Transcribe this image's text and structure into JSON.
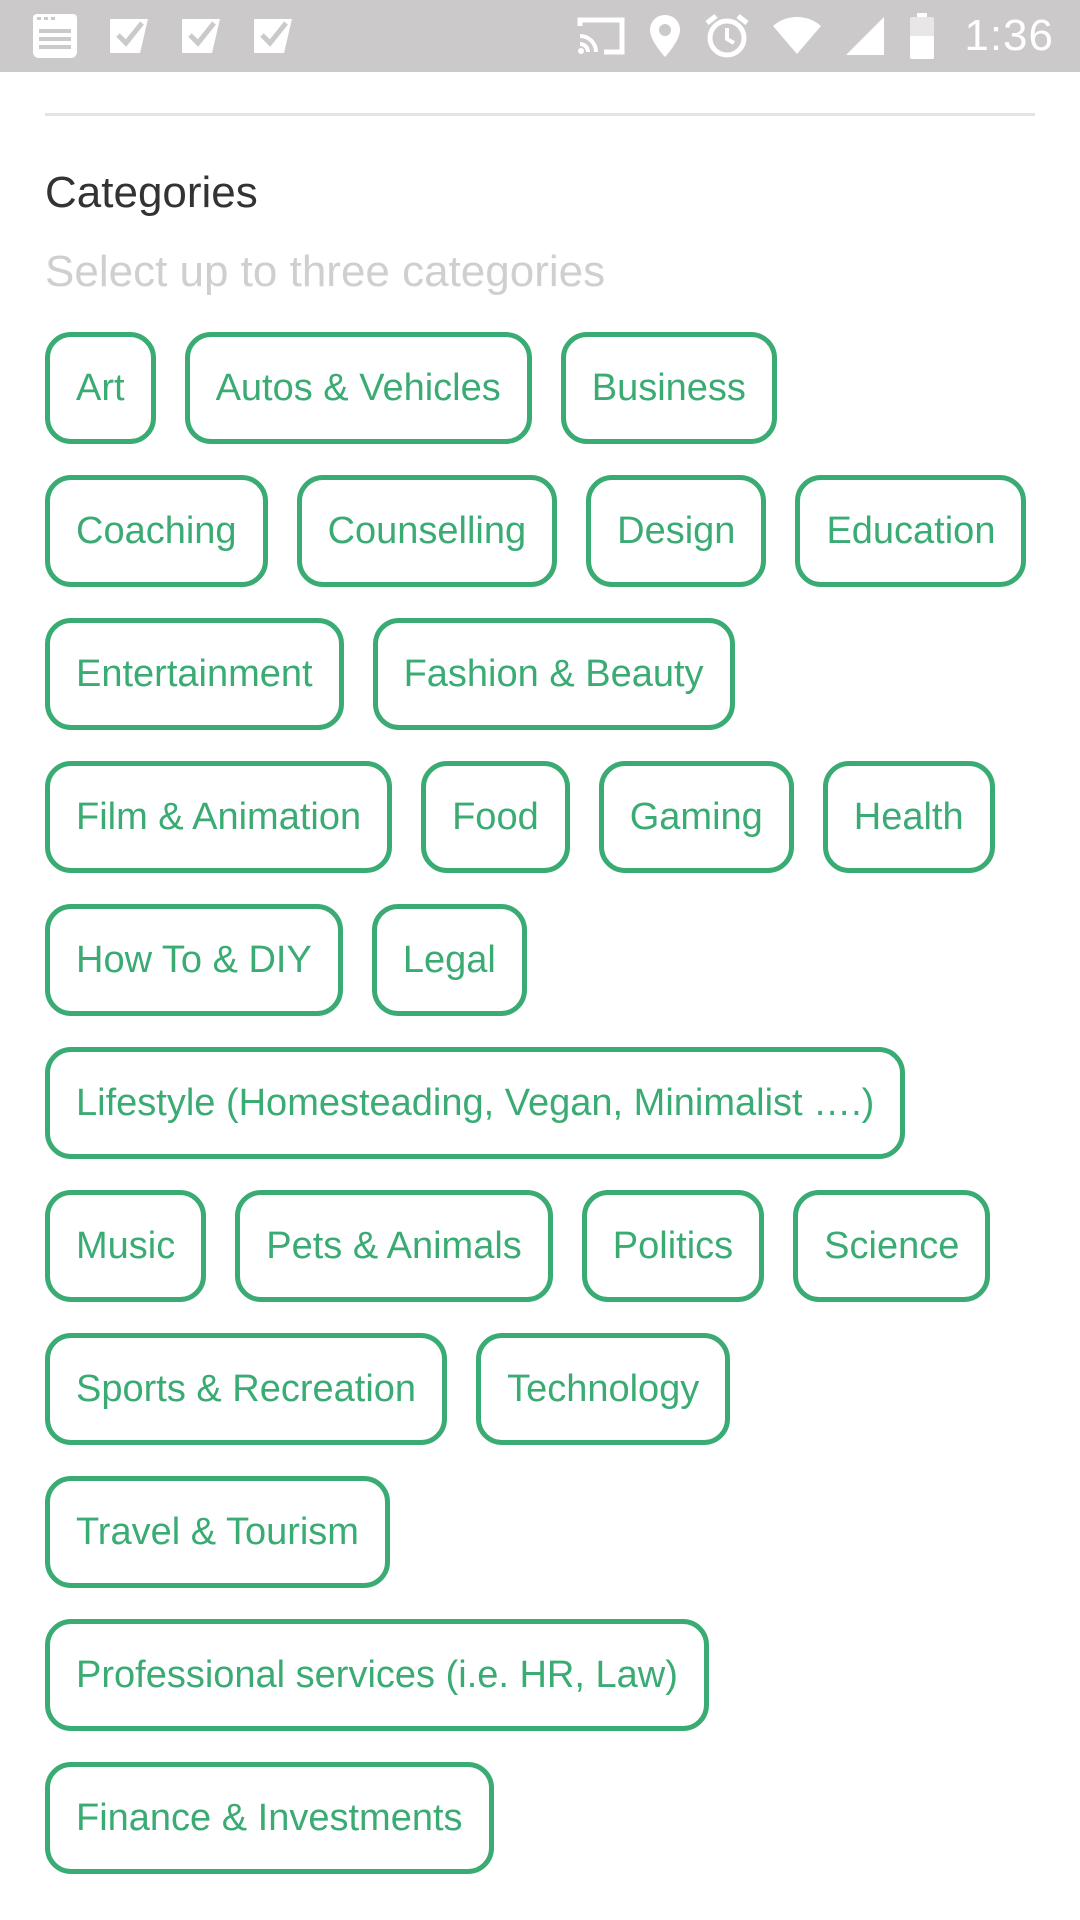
{
  "status_bar": {
    "time": "1:36",
    "left_icons": [
      "notes-icon",
      "check-badge-icon",
      "check-badge-icon",
      "check-badge-icon"
    ],
    "right_icons": [
      "cast-icon",
      "location-pin-icon",
      "alarm-icon",
      "wifi-icon",
      "signal-icon",
      "battery-icon"
    ]
  },
  "categories": {
    "title": "Categories",
    "subtitle": "Select up to three categories",
    "accent_color": "#3bab74",
    "rows": [
      [
        "Art",
        "Autos & Vehicles",
        "Business"
      ],
      [
        "Coaching",
        "Counselling",
        "Design",
        "Education"
      ],
      [
        "Entertainment",
        "Fashion & Beauty"
      ],
      [
        "Film & Animation",
        "Food",
        "Gaming",
        "Health"
      ],
      [
        "How To & DIY",
        "Legal"
      ],
      [
        "Lifestyle (Homesteading, Vegan, Minimalist ….)"
      ],
      [
        "Music",
        "Pets & Animals",
        "Politics",
        "Science"
      ],
      [
        "Sports & Recreation",
        "Technology"
      ],
      [
        "Travel & Tourism"
      ],
      [
        "Professional services (i.e. HR, Law)"
      ],
      [
        "Finance & Investments"
      ]
    ]
  }
}
